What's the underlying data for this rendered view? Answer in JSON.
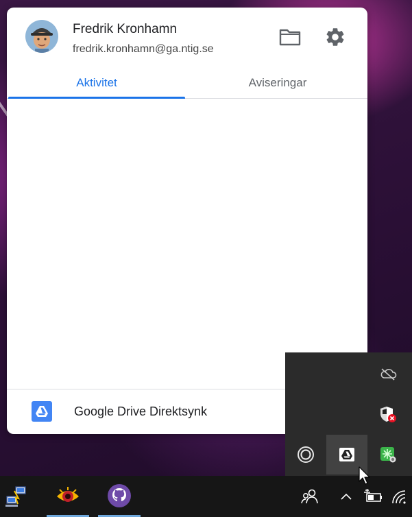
{
  "popup": {
    "user_name": "Fredrik Kronhamn",
    "user_email": "fredrik.kronhamn@ga.ntig.se",
    "tabs": [
      {
        "label": "Aktivitet",
        "active": true
      },
      {
        "label": "Aviseringar",
        "active": false
      }
    ],
    "footer_label": "Google Drive Direktsynk",
    "header_icons": [
      "folder-icon",
      "gear-icon"
    ]
  },
  "tray_overflow_icons": [
    "onedrive-offline-icon",
    "windows-security-warning-icon",
    "green-sync-app-icon",
    "circle-app-icon",
    "google-drive-icon"
  ],
  "taskbar": {
    "apps": [
      "network-tool-app-icon",
      "eye-app-icon",
      "github-desktop-icon"
    ],
    "system_icons": [
      "people-icon",
      "show-hidden-icons-chevron",
      "battery-icon",
      "wifi-icon"
    ]
  },
  "colors": {
    "accent": "#1a73e8",
    "drive_blue": "#4285f4",
    "taskbar": "#161616",
    "flyout": "#2b2b2b"
  }
}
